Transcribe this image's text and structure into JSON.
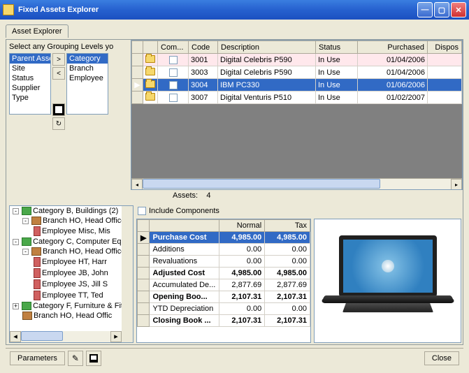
{
  "window": {
    "title": "Fixed Assets Explorer"
  },
  "tab": "Asset Explorer",
  "grouping_caption": "Select any Grouping Levels yo",
  "avail": [
    "Parent Asse",
    "Site",
    "Status",
    "Supplier",
    "Type"
  ],
  "avail_sel": 0,
  "chosen": [
    "Category",
    "Branch",
    "Employee"
  ],
  "chosen_sel": 0,
  "grid": {
    "headers": [
      "",
      "",
      "Com...",
      "Code",
      "Description",
      "Status",
      "Purchased",
      "Dispos"
    ],
    "rows": [
      {
        "code": "3001",
        "desc": "Digital Celebris P590",
        "status": "In Use",
        "purchased": "01/04/2006",
        "alt": true
      },
      {
        "code": "3003",
        "desc": "Digital Celebris P590",
        "status": "In Use",
        "purchased": "01/04/2006"
      },
      {
        "code": "3004",
        "desc": "IBM PC330",
        "status": "In Use",
        "purchased": "01/06/2006",
        "sel": true
      },
      {
        "code": "3007",
        "desc": "Digital Venturis P510",
        "status": "In Use",
        "purchased": "01/02/2007"
      }
    ]
  },
  "assets_label": "Assets:",
  "assets_count": "4",
  "include_label": "Include Components",
  "tree": [
    {
      "lvl": 0,
      "exp": "-",
      "icon": "c",
      "t": "Category B, Buildings (2)"
    },
    {
      "lvl": 1,
      "exp": "-",
      "icon": "b",
      "t": "Branch HO, Head Office"
    },
    {
      "lvl": 2,
      "exp": "",
      "icon": "e",
      "t": "Employee Misc, Mis"
    },
    {
      "lvl": 0,
      "exp": "-",
      "icon": "c",
      "t": "Category C, Computer Equi"
    },
    {
      "lvl": 1,
      "exp": "-",
      "icon": "b",
      "t": "Branch HO, Head Office"
    },
    {
      "lvl": 2,
      "exp": "",
      "icon": "e",
      "t": "Employee HT, Harr"
    },
    {
      "lvl": 2,
      "exp": "",
      "icon": "e",
      "t": "Employee JB, John"
    },
    {
      "lvl": 2,
      "exp": "",
      "icon": "e",
      "t": "Employee JS, Jill S"
    },
    {
      "lvl": 2,
      "exp": "",
      "icon": "e",
      "t": "Employee TT, Ted"
    },
    {
      "lvl": 0,
      "exp": "+",
      "icon": "c",
      "t": "Category F, Furniture & Fittin"
    },
    {
      "lvl": 1,
      "exp": "",
      "icon": "b",
      "t": "Branch HO, Head Offic"
    }
  ],
  "vals": {
    "headers": [
      "",
      "",
      "Normal",
      "Tax"
    ],
    "rows": [
      {
        "l": "Purchase Cost",
        "n": "4,985.00",
        "t": "4,985.00",
        "b": true,
        "sel": true
      },
      {
        "l": "Additions",
        "n": "0.00",
        "t": "0.00"
      },
      {
        "l": "Revaluations",
        "n": "0.00",
        "t": "0.00"
      },
      {
        "l": "Adjusted Cost",
        "n": "4,985.00",
        "t": "4,985.00",
        "b": true
      },
      {
        "l": "Accumulated De...",
        "n": "2,877.69",
        "t": "2,877.69"
      },
      {
        "l": "Opening Boo...",
        "n": "2,107.31",
        "t": "2,107.31",
        "b": true
      },
      {
        "l": "YTD Depreciation",
        "n": "0.00",
        "t": "0.00"
      },
      {
        "l": "Closing Book ...",
        "n": "2,107.31",
        "t": "2,107.31",
        "b": true
      }
    ]
  },
  "footer": {
    "parameters": "Parameters",
    "close": "Close"
  }
}
